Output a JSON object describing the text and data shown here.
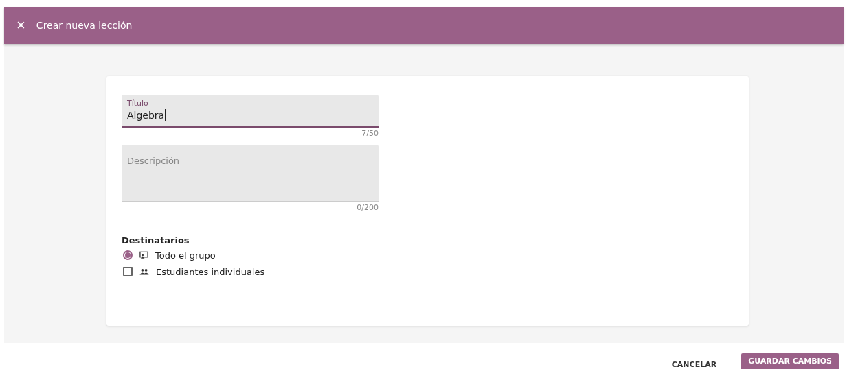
{
  "header": {
    "close": "×",
    "title": "Crear nueva lección"
  },
  "fields": [
    {
      "label": "Título",
      "value": "Algebra",
      "counter": "7/50",
      "focused": true,
      "kind": "line"
    },
    {
      "placeholder": "Descripción",
      "counter": "0/200",
      "focused": false,
      "kind": "area"
    }
  ],
  "recipients": {
    "heading": "Destinatarios",
    "options": [
      {
        "kind": "radio",
        "label": "Todo el grupo",
        "selected": true
      },
      {
        "kind": "checkbox",
        "label": "Estudiantes individuales",
        "checked": false
      }
    ]
  },
  "buttons": [
    {
      "kind": "text",
      "label": "CANCELAR"
    },
    {
      "kind": "filled",
      "label": "GUARDAR CAMBIOS"
    }
  ]
}
